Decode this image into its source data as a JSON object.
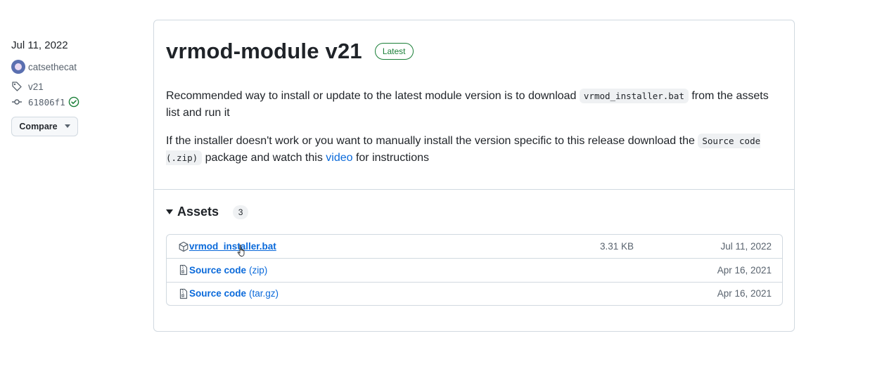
{
  "sidebar": {
    "date": "Jul 11, 2022",
    "author": "catsethecat",
    "tag": "v21",
    "commit": "61806f1",
    "compare_label": "Compare"
  },
  "release": {
    "title": "vrmod-module v21",
    "badge": "Latest",
    "p1_before": "Recommended way to install or update to the latest module version is to download ",
    "p1_code": "vrmod_installer.bat",
    "p1_after": " from the assets list and run it",
    "p2_before": "If the installer doesn't work or you want to manually install the version specific to this release download the ",
    "p2_code": "Source code (.zip)",
    "p2_mid": " package and watch this ",
    "p2_link": "video",
    "p2_after": " for instructions"
  },
  "assets": {
    "title": "Assets",
    "count": "3",
    "items": [
      {
        "name": "vrmod_installer.bat",
        "suffix": "",
        "size": "3.31 KB",
        "date": "Jul 11, 2022",
        "icon": "package-icon"
      },
      {
        "name": "Source code",
        "suffix": "(zip)",
        "size": "",
        "date": "Apr 16, 2021",
        "icon": "file-zip-icon"
      },
      {
        "name": "Source code",
        "suffix": "(tar.gz)",
        "size": "",
        "date": "Apr 16, 2021",
        "icon": "file-zip-icon"
      }
    ]
  },
  "colors": {
    "link": "#0969da",
    "success": "#1a7f37",
    "border": "#d1d9e0",
    "muted": "#59636e"
  }
}
